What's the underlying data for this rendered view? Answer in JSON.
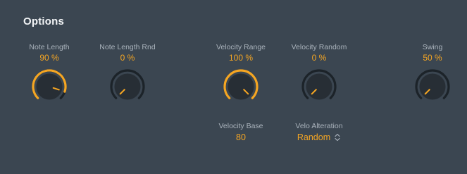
{
  "title": "Options",
  "colors": {
    "background": "#3b4651",
    "accent": "#f5a623",
    "label": "#aab3bc",
    "knob_face": "#272e35",
    "track": "#1c2329"
  },
  "controls": [
    {
      "label": "Note Length",
      "value": "90 %",
      "level": 0.9
    },
    {
      "label": "Note Length Rnd",
      "value": "0 %",
      "level": 0.0
    },
    {
      "label": "Velocity Range",
      "value": "100 %",
      "level": 1.0
    },
    {
      "label": "Velocity Random",
      "value": "0 %",
      "level": 0.0
    },
    {
      "label": "Swing",
      "value": "50 %",
      "level": 0.0
    }
  ],
  "velocity_base": {
    "label": "Velocity Base",
    "value": "80"
  },
  "velo_alteration": {
    "label": "Velo Alteration",
    "value": "Random",
    "icon": "updown-chevron-icon"
  }
}
